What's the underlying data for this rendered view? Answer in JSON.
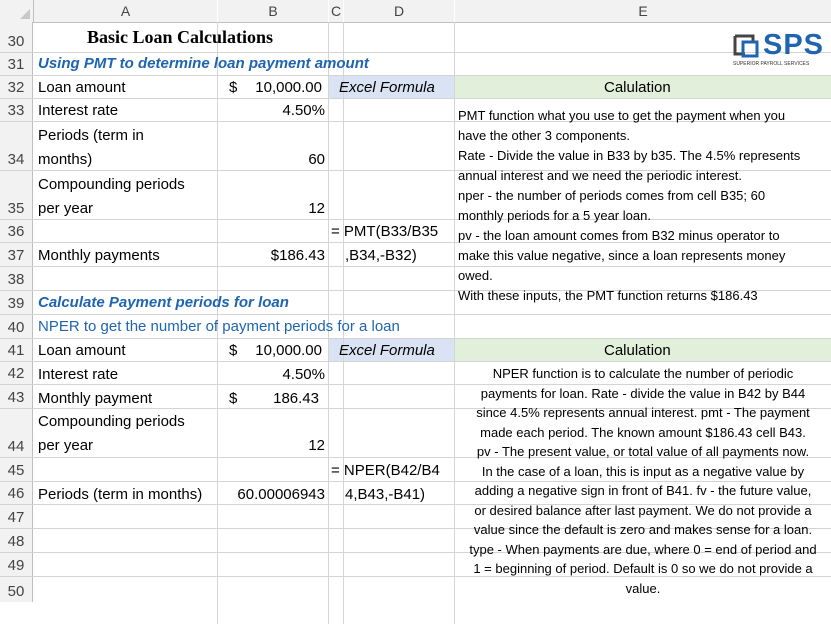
{
  "columns": [
    "A",
    "B",
    "C",
    "D",
    "E"
  ],
  "rows": [
    "30",
    "31",
    "32",
    "33",
    "34",
    "35",
    "36",
    "37",
    "38",
    "39",
    "40",
    "41",
    "42",
    "43",
    "44",
    "45",
    "46",
    "47",
    "48",
    "49",
    "50"
  ],
  "logo": {
    "text": "SPS",
    "tagline": "SUPERIOR PAYROLL SERVICES",
    "color": "#1f64b0"
  },
  "section1": {
    "title": "Basic Loan Calculations",
    "subtitle": "Using PMT to determine loan payment amount",
    "loan_label": "Loan amount",
    "loan_currency": "$",
    "loan_value": "10,000.00",
    "formula_header": "Excel Formula",
    "calc_header": "Calulation",
    "rate_label": "Interest rate",
    "rate_value": "4.50%",
    "periods_label_1": "Periods (term in",
    "periods_label_2": "months)",
    "periods_value": "60",
    "comp_label_1": "Compounding periods",
    "comp_label_2": "per year",
    "comp_value": "12",
    "formula_1": "= PMT(B33/B35",
    "formula_2": ",B34,-B32)",
    "monthly_label": "Monthly payments",
    "monthly_value": "$186.43",
    "notes": [
      "PMT function what you use to get the payment when you",
      "have the other 3 components.",
      "Rate - Divide the value in B33 by b35. The 4.5% represents",
      "annual interest and we need the periodic interest.",
      "nper - the number of periods comes from cell B35; 60",
      "monthly periods for a 5 year loan.",
      "pv - the loan amount comes from B32 minus operator to",
      "make this value negative, since a loan represents money",
      "owed.",
      "With these inputs, the PMT function returns $186.43"
    ]
  },
  "section2": {
    "subtitle": "Calculate Payment periods for loan",
    "nper_intro": "NPER to get the number of payment periods for a loan",
    "loan_label": "Loan amount",
    "loan_currency": "$",
    "loan_value": "10,000.00",
    "formula_header": "Excel Formula",
    "calc_header": "Calulation",
    "rate_label": "Interest rate",
    "rate_value": "4.50%",
    "monthly_label": "Monthly payment",
    "monthly_currency": "$",
    "monthly_value": "186.43",
    "comp_label_1": "Compounding periods",
    "comp_label_2": "per year",
    "comp_value": "12",
    "formula_1": "= NPER(B42/B4",
    "formula_2": "4,B43,-B41)",
    "periods_label": "Periods (term in months)",
    "periods_value": "60.00006943",
    "notes": [
      "NPER function is to calculate the number of periodic",
      "payments for loan. Rate - divide the value in B42 by B44",
      "since 4.5% represents annual interest. pmt - The payment",
      "made each period. The known amount $186.43 cell B43.",
      "pv - The present value, or total value of all payments now.",
      "In the case of a loan, this is input as a negative value by",
      "adding a negative sign in front of B41. fv - the future value,",
      "or desired balance after last payment. We do not provide a",
      "value since the default is zero and makes sense for a loan.",
      "type - When payments are due, where 0 = end of period and",
      "1 = beginning of period. Default is 0 so we do not provide a",
      "value."
    ]
  }
}
